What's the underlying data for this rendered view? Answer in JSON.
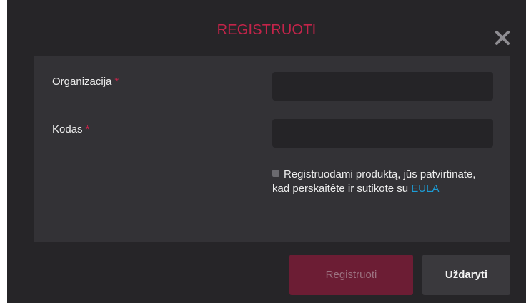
{
  "dialog": {
    "title": "REGISTRUOTI",
    "close_icon": "close-icon"
  },
  "form": {
    "organization": {
      "label": "Organizacija",
      "required_mark": "*",
      "value": ""
    },
    "code": {
      "label": "Kodas",
      "required_mark": "*",
      "value": ""
    },
    "consent": {
      "checked": false,
      "text": "Registruodami produktą, jūs patvirtinate, kad perskaitėte ir sutikote su",
      "link_text": "EULA"
    }
  },
  "buttons": {
    "register_label": "Registruoti",
    "close_label": "Uždaryti"
  },
  "colors": {
    "background": "#262528",
    "panel": "#333236",
    "accent": "#c4244a",
    "link": "#1c9ed8"
  }
}
